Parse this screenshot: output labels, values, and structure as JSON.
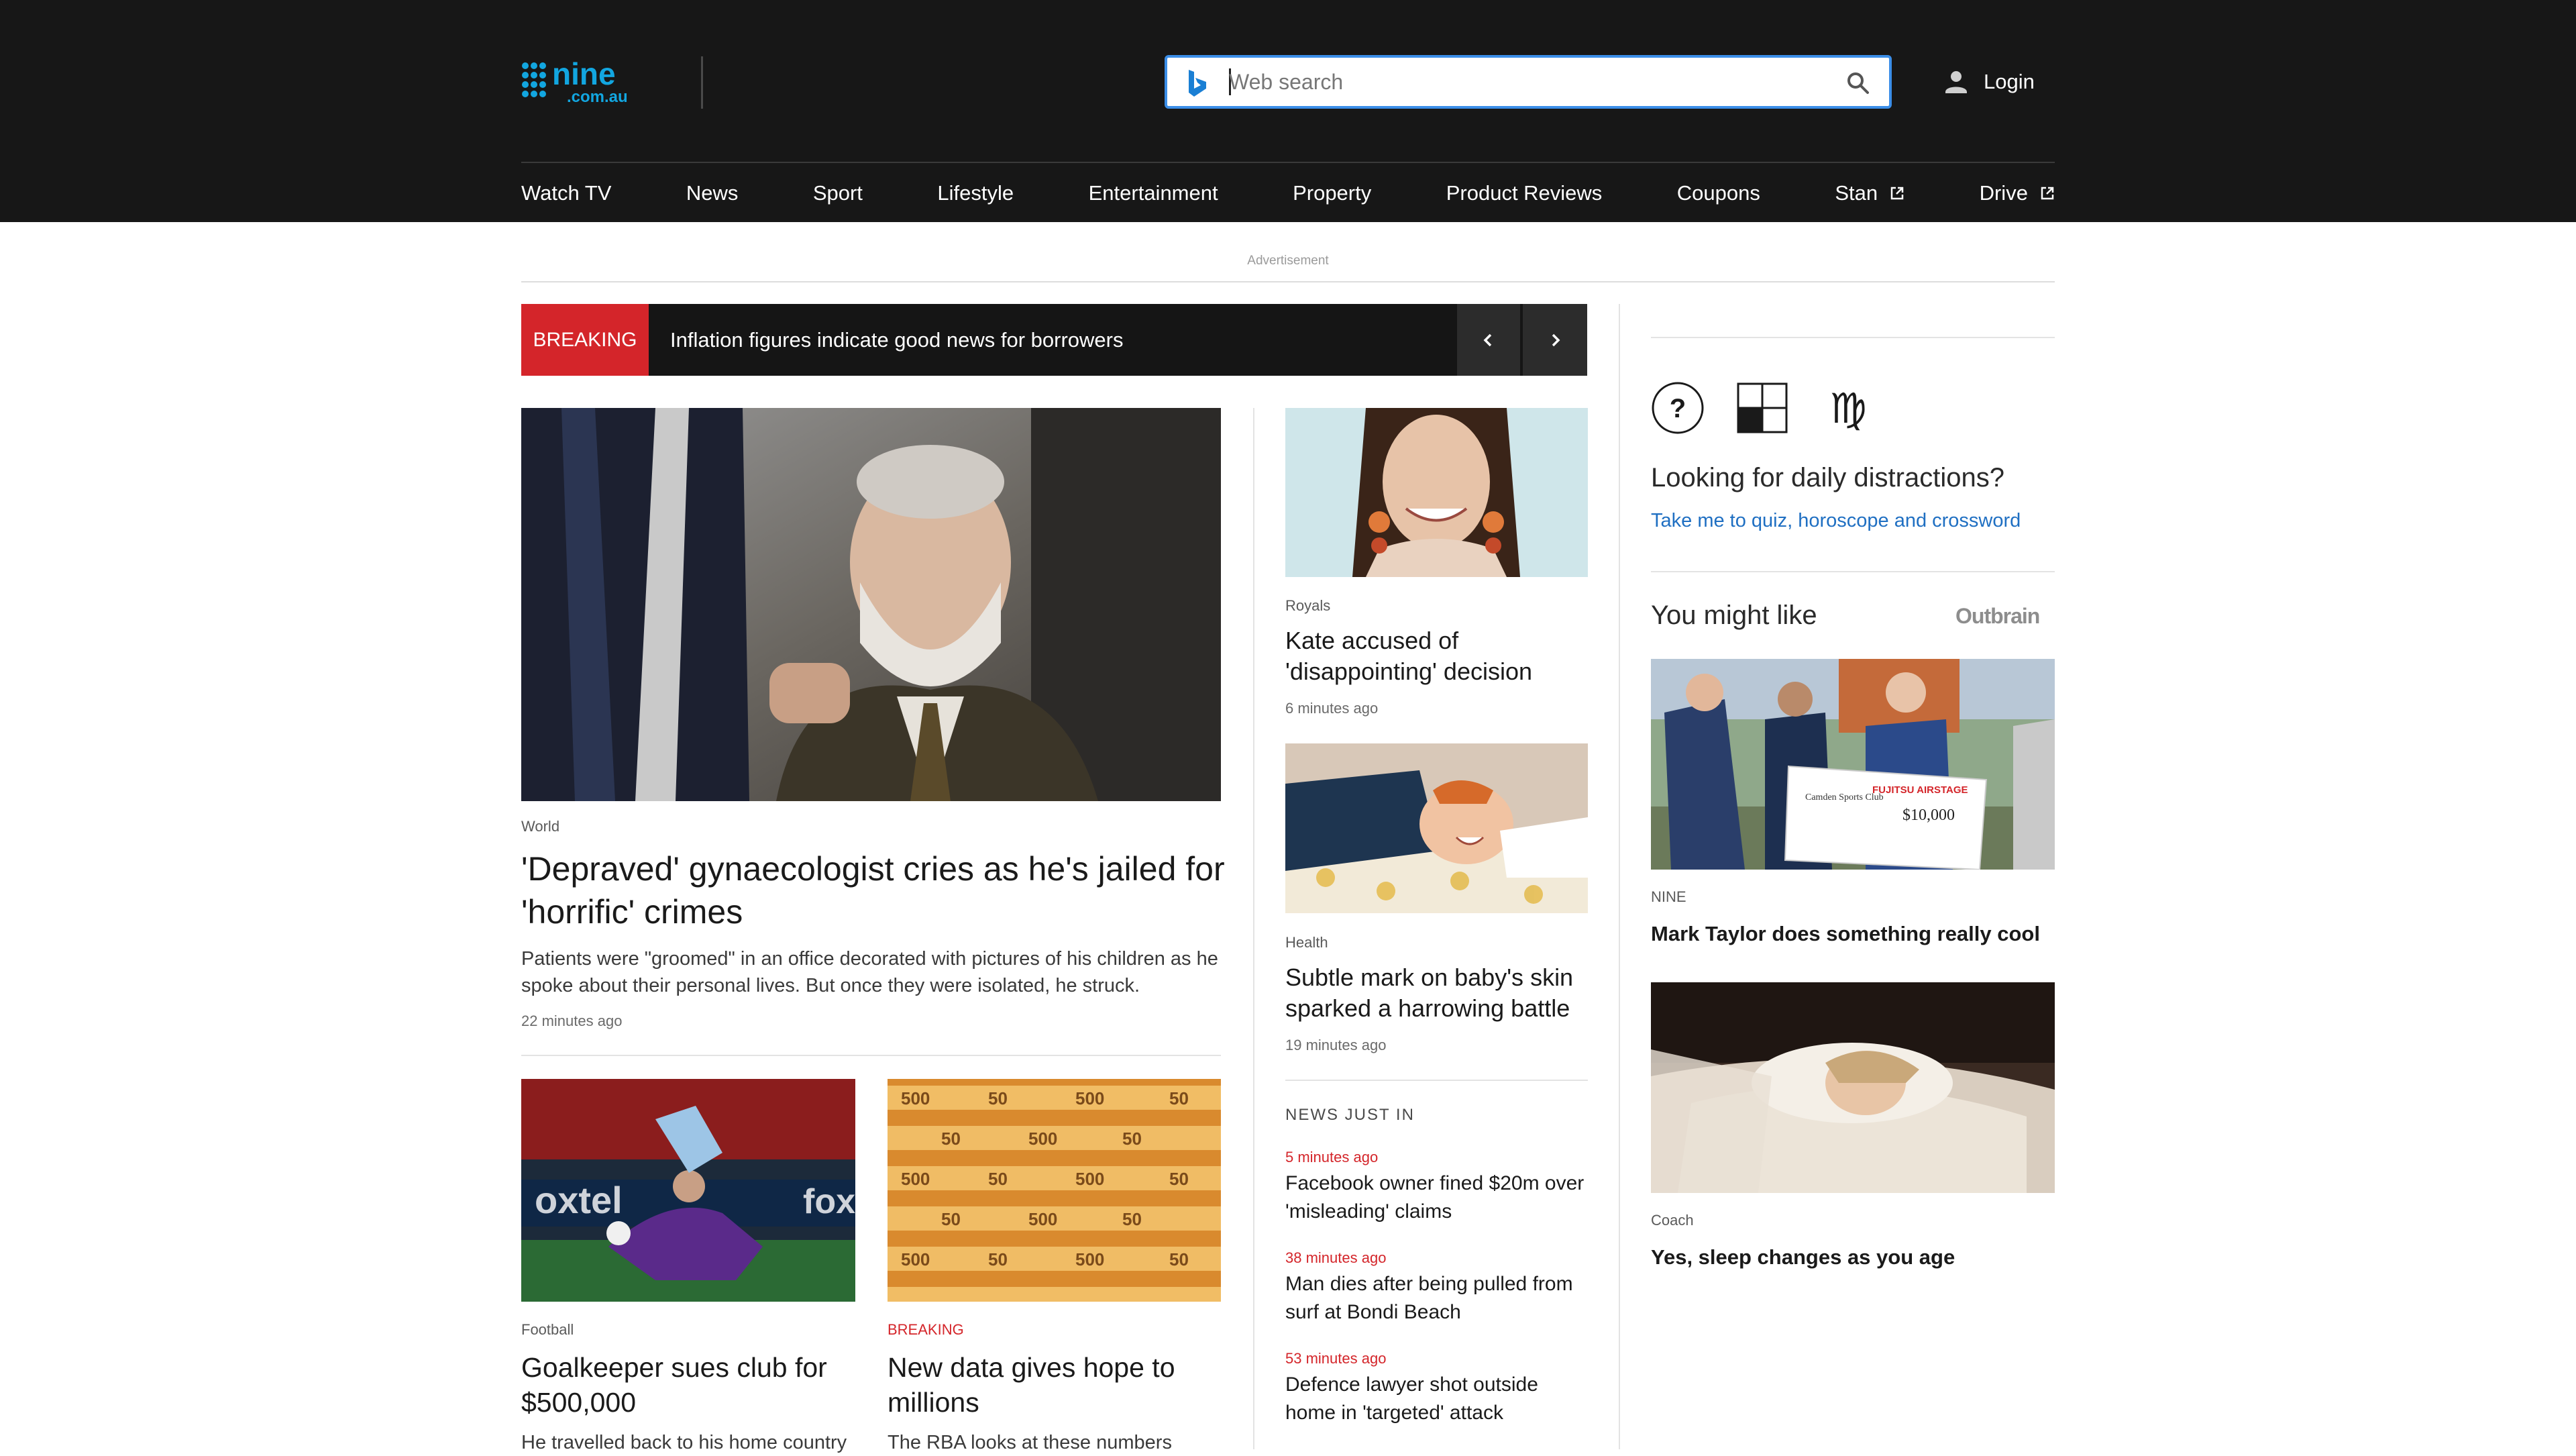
{
  "header": {
    "logo_text": "nine.com.au",
    "search": {
      "placeholder": "Web search",
      "value": ""
    },
    "login_label": "Login",
    "colors": {
      "background": "#171717",
      "search_border": "#3b8ee8",
      "bing": "#1a7fd4",
      "logo": "#12a6e0"
    }
  },
  "nav": {
    "items": [
      {
        "label": "Watch TV",
        "external": false
      },
      {
        "label": "News",
        "external": false
      },
      {
        "label": "Sport",
        "external": false
      },
      {
        "label": "Lifestyle",
        "external": false
      },
      {
        "label": "Entertainment",
        "external": false
      },
      {
        "label": "Property",
        "external": false
      },
      {
        "label": "Product Reviews",
        "external": false
      },
      {
        "label": "Coupons",
        "external": false
      },
      {
        "label": "Stan",
        "external": true,
        "icon": "external-link-icon"
      },
      {
        "label": "Drive",
        "external": true,
        "icon": "external-link-icon"
      }
    ]
  },
  "advertisement_label": "Advertisement",
  "breaking": {
    "tag": "BREAKING",
    "headline": "Inflation figures indicate good news for borrowers",
    "accent": "#d4252a"
  },
  "lead": {
    "kicker": "World",
    "headline": "'Depraved' gynaecologist cries as he's jailed for 'horrific' crimes",
    "summary": "Patients were \"groomed\" in an office decorated with pictures of his children as he spoke about their personal lives. But once they were isolated, he struck.",
    "time": "22 minutes ago"
  },
  "lower_stories": [
    {
      "kicker": "Football",
      "headline": "Goalkeeper sues club for $500,000",
      "summary": "He travelled back to his home country"
    },
    {
      "kicker": "BREAKING",
      "headline": "New data gives hope to millions",
      "summary": "The RBA looks at these numbers"
    }
  ],
  "middle_stories": [
    {
      "kicker": "Royals",
      "headline": "Kate accused of 'disappointing' decision",
      "time": "6 minutes ago"
    },
    {
      "kicker": "Health",
      "headline": "Subtle mark on baby's skin sparked a harrowing battle",
      "time": "19 minutes ago"
    }
  ],
  "news_just_in": {
    "title": "NEWS JUST IN",
    "items": [
      {
        "time": "5 minutes ago",
        "headline": "Facebook owner fined $20m over 'misleading' claims"
      },
      {
        "time": "38 minutes ago",
        "headline": "Man dies after being pulled from surf at Bondi Beach"
      },
      {
        "time": "53 minutes ago",
        "headline": "Defence lawyer shot outside home in 'targeted' attack"
      }
    ]
  },
  "rail": {
    "icons": [
      "quiz-icon",
      "crossword-icon",
      "horoscope-icon"
    ],
    "distractions_title": "Looking for daily distractions?",
    "distractions_link": "Take me to quiz, horoscope and crossword",
    "you_might_like": "You might like",
    "outbrain_label": "Outbrain",
    "cards": [
      {
        "source": "NINE",
        "headline": "Mark Taylor does something really cool",
        "cheque_club": "Camden Sports Club",
        "cheque_amount": "$10,000",
        "cheque_brand": "FUJITSU AIRSTAGE"
      },
      {
        "source": "Coach",
        "headline": "Yes, sleep changes as you age"
      }
    ]
  }
}
